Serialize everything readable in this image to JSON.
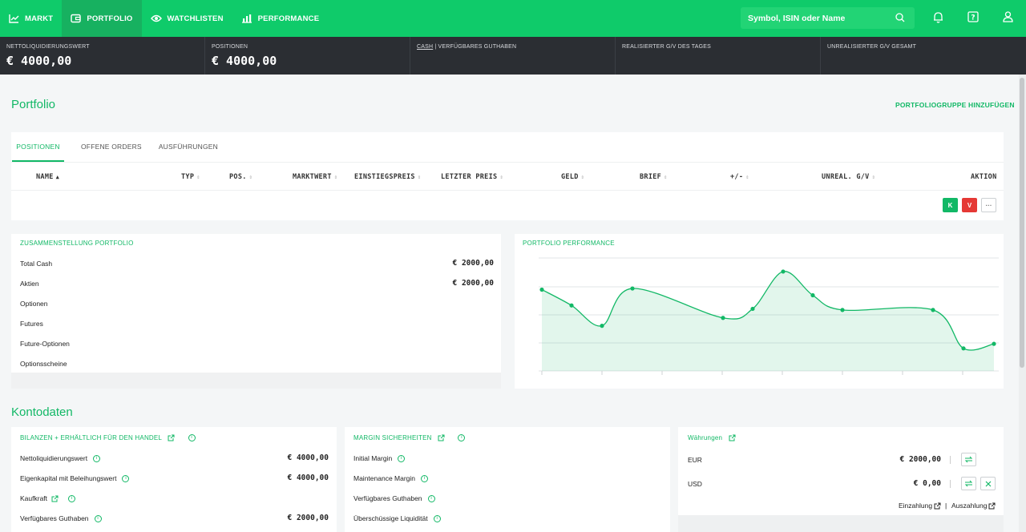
{
  "nav": {
    "items": [
      {
        "label": "MARKT",
        "icon": "chart-line-icon",
        "active": false
      },
      {
        "label": "PORTFOLIO",
        "icon": "wallet-icon",
        "active": true
      },
      {
        "label": "WATCHLISTEN",
        "icon": "eye-icon",
        "active": false
      },
      {
        "label": "PERFORMANCE",
        "icon": "bar-chart-icon",
        "active": false
      }
    ],
    "search_placeholder": "Symbol, ISIN oder Name"
  },
  "summary": {
    "cells": [
      {
        "label": "NETTOLIQUIDIERUNGSWERT",
        "value": "€ 4000,00"
      },
      {
        "label": "POSITIONEN",
        "value": "€ 4000,00"
      },
      {
        "label_link": "CASH",
        "label_rest": " | VERFÜGBARES GUTHABEN",
        "value": ""
      },
      {
        "label": "REALISIERTER G/V DES TAGES",
        "value": ""
      },
      {
        "label": "UNREALISIERTER G/V GESAMT",
        "value": ""
      }
    ]
  },
  "portfolio": {
    "title": "Portfolio",
    "add_group": "PORTFOLIOGRUPPE HINZUFÜGEN",
    "tabs": [
      "POSITIONEN",
      "OFFENE ORDERS",
      "AUSFÜHRUNGEN"
    ],
    "columns": [
      "NAME",
      "TYP",
      "POS.",
      "MARKTWERT",
      "EINSTIEGSPREIS",
      "LETZTER PREIS",
      "GELD",
      "BRIEF",
      "+/-",
      "UNREAL. G/V",
      "AKTION"
    ],
    "actions": {
      "buy": "K",
      "sell": "V",
      "more": "···"
    }
  },
  "composition": {
    "title": "ZUSAMMENSTELLUNG PORTFOLIO",
    "rows": [
      {
        "label": "Total Cash",
        "value": "€ 2000,00"
      },
      {
        "label": "Aktien",
        "value": "€ 2000,00"
      },
      {
        "label": "Optionen",
        "value": ""
      },
      {
        "label": "Futures",
        "value": ""
      },
      {
        "label": "Future-Optionen",
        "value": ""
      },
      {
        "label": "Optionsscheine",
        "value": ""
      }
    ]
  },
  "performance": {
    "title": "PORTFOLIO PERFORMANCE"
  },
  "chart_data": {
    "type": "area",
    "x": [
      0,
      1,
      2,
      3,
      4,
      5,
      6,
      7,
      8,
      9,
      10,
      11
    ],
    "series": [
      {
        "values": [
          0.28,
          0.42,
          0.6,
          0.27,
          0.53,
          0.45,
          0.12,
          0.33,
          0.46,
          0.46,
          0.8,
          0.76
        ]
      }
    ],
    "grid": true,
    "color": "#12b866"
  },
  "kontodaten": {
    "title": "Kontodaten",
    "bilanzen": {
      "title": "BILANZEN + ERHÄLTLICH FÜR DEN HANDEL",
      "rows": [
        {
          "label": "Nettoliquidierungswert",
          "value": "€ 4000,00"
        },
        {
          "label": "Eigenkapital mit Beleihungswert",
          "value": "€ 4000,00"
        },
        {
          "label": "Kaufkraft",
          "value": ""
        },
        {
          "label": "Verfügbares Guthaben",
          "value": "€ 2000,00"
        }
      ]
    },
    "margin": {
      "title": "MARGIN SICHERHEITEN",
      "rows": [
        {
          "label": "Initial Margin"
        },
        {
          "label": "Maintenance Margin"
        },
        {
          "label": "Verfügbares Guthaben"
        },
        {
          "label": "Überschüssige Liquidität"
        }
      ]
    },
    "currencies": {
      "title": "Währungen",
      "rows": [
        {
          "code": "EUR",
          "value": "€ 2000,00"
        },
        {
          "code": "USD",
          "value": "€ 0,00"
        }
      ],
      "deposit": "Einzahlung",
      "withdraw": "Auszahlung"
    }
  },
  "colors": {
    "accent": "#12b866",
    "nav": "#0fcb6a",
    "sell": "#e53935",
    "dark": "#2b2e33"
  }
}
